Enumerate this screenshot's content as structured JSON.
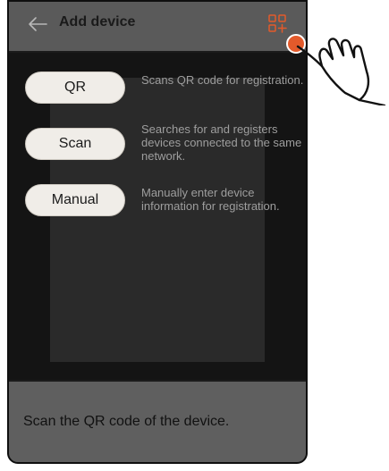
{
  "header": {
    "title": "Add device",
    "back_icon": "back-arrow-icon",
    "add_qr_icon": "qr-add-icon"
  },
  "options": [
    {
      "label": "QR",
      "description": "Scans QR code for registration."
    },
    {
      "label": "Scan",
      "description": "Searches for and registers devices connected to the same network."
    },
    {
      "label": "Manual",
      "description": "Manually enter device information for registration."
    }
  ],
  "footer": {
    "text": "Scan the QR code of the device."
  },
  "colors": {
    "header_bg": "#5a5a5a",
    "content_bg": "#141414",
    "button_bg": "#f0ede8",
    "accent": "#e35a2b"
  }
}
